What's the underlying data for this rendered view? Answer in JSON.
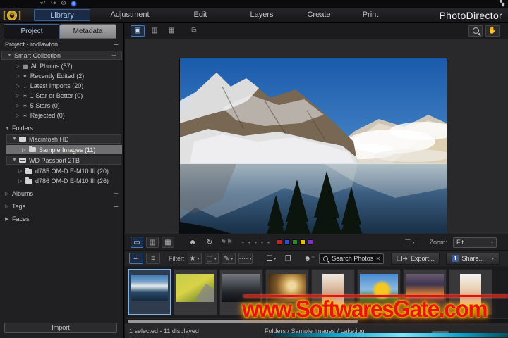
{
  "app": {
    "title": "PhotoDirector"
  },
  "menu": {
    "items": [
      "Library",
      "Adjustment",
      "Edit",
      "Layers",
      "Create",
      "Print"
    ]
  },
  "panel_tabs": {
    "project": "Project",
    "metadata": "Metadata"
  },
  "sidebar": {
    "project_header": "Project - rodlawton",
    "smart_collection": {
      "header": "Smart Collection",
      "items": [
        "All Photos (57)",
        "Recently Edited (2)",
        "Latest Imports (20)",
        "1 Star or Better (0)",
        "5 Stars (0)",
        "Rejected (0)"
      ]
    },
    "folders": {
      "header": "Folders",
      "drive1": "Macintosh HD",
      "selected_folder": "Sample Images (11)",
      "drive2": "WD Passport 2TB",
      "folder2": "d785 OM-D E-M10 III (20)",
      "folder3": "d786 OM-D E-M10 III (26)"
    },
    "albums": "Albums",
    "tags": "Tags",
    "faces": "Faces",
    "import_label": "Import"
  },
  "toolbar": {
    "zoom_label": "Zoom:",
    "zoom_value": "Fit",
    "filter_label": "Filter:",
    "search_placeholder": "Search Photos",
    "export_label": "Export...",
    "share_label": "Share..."
  },
  "status": {
    "selection": "1 selected - 11 displayed",
    "path": "Folders / Sample Images / Lake.jpg"
  },
  "watermark": {
    "text": "www.SoftwaresGate.com"
  },
  "colors": {
    "label_red": "#cf2020",
    "label_blue": "#3050cc",
    "label_green": "#2e8b2e",
    "label_yellow": "#e0c000",
    "label_purple": "#8030d0",
    "accent": "#7fb2e5"
  },
  "glyphs": {
    "undo": "↶",
    "redo": "↷",
    "gear": "⚙",
    "window": "▚",
    "caret_open": "▼",
    "caret_closed": "▷",
    "caret_solid": "▶",
    "plus": "+",
    "all_photos": "▦",
    "wand": "✶",
    "import_arrow": "↧",
    "aperture": "✳",
    "view_photo": "▣",
    "view_browse": "▥",
    "view_grid": "▦",
    "view_compare": "⧉",
    "hand": "✋",
    "single": "▭",
    "double": "▥",
    "grid3": "▦",
    "face_tag": "☻",
    "rotate": "↻",
    "flags": "⚑⚑",
    "dots5": "• • • • •",
    "film": "▪▪▪",
    "list": "≡",
    "star": "★",
    "square": "▢",
    "pen": "✎",
    "dots4": "····",
    "sortlist": "☰",
    "stack": "❐",
    "person_add": "☻⁺",
    "arrow_down": "▾",
    "close": "✕",
    "fb": "f",
    "export_icon": "❏➜"
  },
  "thumbnails": [
    {
      "name": "lake"
    },
    {
      "name": "meadow-bicycle"
    },
    {
      "name": "storm-landscape"
    },
    {
      "name": "golden-spiral"
    },
    {
      "name": "woman-portrait"
    },
    {
      "name": "sunflower"
    },
    {
      "name": "sunset-clouds"
    },
    {
      "name": "laughing-woman"
    }
  ]
}
